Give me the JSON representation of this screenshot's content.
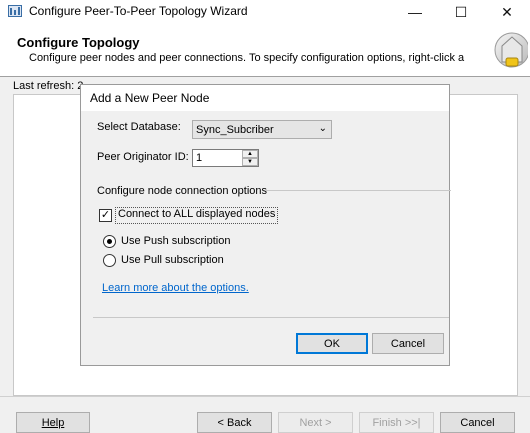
{
  "window": {
    "title": "Configure Peer-To-Peer Topology Wizard",
    "minimize_icon": "minimize-icon",
    "maximize_icon": "maximize-icon",
    "close_icon": "close-icon"
  },
  "header": {
    "title": "Configure Topology",
    "subtitle": "Configure peer nodes and peer connections. To specify configuration options, right-click a"
  },
  "main": {
    "last_refresh_label": "Last refresh: 2"
  },
  "dialog": {
    "title": "Add a New Peer Node",
    "select_database_label": "Select Database:",
    "select_database_value": "Sync_Subcriber",
    "peer_originator_label": "Peer Originator ID:",
    "peer_originator_value": "1",
    "group_label": "Configure node connection options",
    "connect_all_label": "Connect to ALL displayed nodes",
    "connect_all_checked": true,
    "push_label": "Use Push subscription",
    "pull_label": "Use Pull subscription",
    "selected_subscription": "push",
    "learn_more_link": "Learn more about the options.",
    "ok_label": "OK",
    "cancel_label": "Cancel"
  },
  "footer": {
    "help_label": "Help",
    "back_label": "< Back",
    "next_label": "Next >",
    "finish_label": "Finish >>|",
    "cancel_label": "Cancel"
  },
  "colors": {
    "link": "#0066cc",
    "default_button_border": "#0078d7"
  }
}
